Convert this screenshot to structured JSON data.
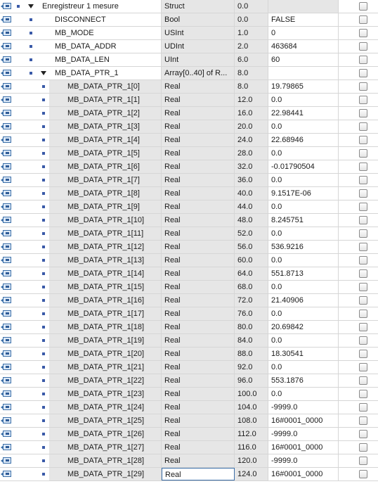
{
  "rows": [
    {
      "name": "Enregistreur 1 mesure",
      "type": "Struct",
      "offset": "0.0",
      "value": "",
      "level": 0,
      "expander": true
    },
    {
      "name": "DISCONNECT",
      "type": "Bool",
      "offset": "0.0",
      "value": "FALSE",
      "level": 1,
      "expander": false
    },
    {
      "name": "MB_MODE",
      "type": "USInt",
      "offset": "1.0",
      "value": "0",
      "level": 1,
      "expander": false
    },
    {
      "name": "MB_DATA_ADDR",
      "type": "UDInt",
      "offset": "2.0",
      "value": "463684",
      "level": 1,
      "expander": false
    },
    {
      "name": "MB_DATA_LEN",
      "type": "UInt",
      "offset": "6.0",
      "value": "60",
      "level": 1,
      "expander": false
    },
    {
      "name": "MB_DATA_PTR_1",
      "type": "Array[0..40] of R...",
      "offset": "8.0",
      "value": "",
      "level": 1,
      "expander": true
    },
    {
      "name": "MB_DATA_PTR_1[0]",
      "type": "Real",
      "offset": "8.0",
      "value": "19.79865",
      "level": 2
    },
    {
      "name": "MB_DATA_PTR_1[1]",
      "type": "Real",
      "offset": "12.0",
      "value": "0.0",
      "level": 2
    },
    {
      "name": "MB_DATA_PTR_1[2]",
      "type": "Real",
      "offset": "16.0",
      "value": "22.98441",
      "level": 2
    },
    {
      "name": "MB_DATA_PTR_1[3]",
      "type": "Real",
      "offset": "20.0",
      "value": "0.0",
      "level": 2
    },
    {
      "name": "MB_DATA_PTR_1[4]",
      "type": "Real",
      "offset": "24.0",
      "value": "22.68946",
      "level": 2
    },
    {
      "name": "MB_DATA_PTR_1[5]",
      "type": "Real",
      "offset": "28.0",
      "value": "0.0",
      "level": 2
    },
    {
      "name": "MB_DATA_PTR_1[6]",
      "type": "Real",
      "offset": "32.0",
      "value": "-0.01790504",
      "level": 2
    },
    {
      "name": "MB_DATA_PTR_1[7]",
      "type": "Real",
      "offset": "36.0",
      "value": "0.0",
      "level": 2
    },
    {
      "name": "MB_DATA_PTR_1[8]",
      "type": "Real",
      "offset": "40.0",
      "value": "9.1517E-06",
      "level": 2
    },
    {
      "name": "MB_DATA_PTR_1[9]",
      "type": "Real",
      "offset": "44.0",
      "value": "0.0",
      "level": 2
    },
    {
      "name": "MB_DATA_PTR_1[10]",
      "type": "Real",
      "offset": "48.0",
      "value": "8.245751",
      "level": 2
    },
    {
      "name": "MB_DATA_PTR_1[11]",
      "type": "Real",
      "offset": "52.0",
      "value": "0.0",
      "level": 2
    },
    {
      "name": "MB_DATA_PTR_1[12]",
      "type": "Real",
      "offset": "56.0",
      "value": "536.9216",
      "level": 2
    },
    {
      "name": "MB_DATA_PTR_1[13]",
      "type": "Real",
      "offset": "60.0",
      "value": "0.0",
      "level": 2
    },
    {
      "name": "MB_DATA_PTR_1[14]",
      "type": "Real",
      "offset": "64.0",
      "value": "551.8713",
      "level": 2
    },
    {
      "name": "MB_DATA_PTR_1[15]",
      "type": "Real",
      "offset": "68.0",
      "value": "0.0",
      "level": 2
    },
    {
      "name": "MB_DATA_PTR_1[16]",
      "type": "Real",
      "offset": "72.0",
      "value": "21.40906",
      "level": 2
    },
    {
      "name": "MB_DATA_PTR_1[17]",
      "type": "Real",
      "offset": "76.0",
      "value": "0.0",
      "level": 2
    },
    {
      "name": "MB_DATA_PTR_1[18]",
      "type": "Real",
      "offset": "80.0",
      "value": "20.69842",
      "level": 2
    },
    {
      "name": "MB_DATA_PTR_1[19]",
      "type": "Real",
      "offset": "84.0",
      "value": "0.0",
      "level": 2
    },
    {
      "name": "MB_DATA_PTR_1[20]",
      "type": "Real",
      "offset": "88.0",
      "value": "18.30541",
      "level": 2
    },
    {
      "name": "MB_DATA_PTR_1[21]",
      "type": "Real",
      "offset": "92.0",
      "value": "0.0",
      "level": 2
    },
    {
      "name": "MB_DATA_PTR_1[22]",
      "type": "Real",
      "offset": "96.0",
      "value": "553.1876",
      "level": 2
    },
    {
      "name": "MB_DATA_PTR_1[23]",
      "type": "Real",
      "offset": "100.0",
      "value": "0.0",
      "level": 2
    },
    {
      "name": "MB_DATA_PTR_1[24]",
      "type": "Real",
      "offset": "104.0",
      "value": "-9999.0",
      "level": 2
    },
    {
      "name": "MB_DATA_PTR_1[25]",
      "type": "Real",
      "offset": "108.0",
      "value": "16#0001_0000",
      "level": 2
    },
    {
      "name": "MB_DATA_PTR_1[26]",
      "type": "Real",
      "offset": "112.0",
      "value": "-9999.0",
      "level": 2
    },
    {
      "name": "MB_DATA_PTR_1[27]",
      "type": "Real",
      "offset": "116.0",
      "value": "16#0001_0000",
      "level": 2
    },
    {
      "name": "MB_DATA_PTR_1[28]",
      "type": "Real",
      "offset": "120.0",
      "value": "-9999.0",
      "level": 2
    },
    {
      "name": "MB_DATA_PTR_1[29]",
      "type": "Real",
      "offset": "124.0",
      "value": "16#0001_0000",
      "level": 2,
      "selected": true
    }
  ],
  "icons": {
    "row_icon": "interface-in-icon",
    "bullet": "member-bullet-icon",
    "expand": "collapse-triangle-icon",
    "check": "checkbox"
  }
}
